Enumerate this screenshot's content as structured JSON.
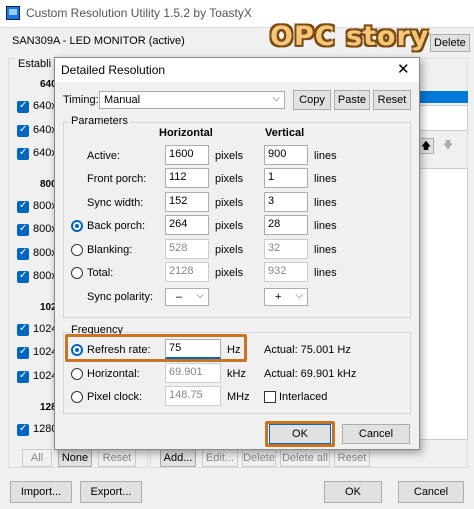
{
  "app": {
    "title": "Custom Resolution Utility 1.5.2 by ToastyX",
    "monitor": "SAN309A - LED MONITOR (active)",
    "delete_label": "Delete",
    "watermark": "OPC story"
  },
  "background": {
    "group_label": "Establi",
    "sections": [
      {
        "label": "640",
        "items": [
          "640x",
          "640x",
          "640x"
        ]
      },
      {
        "label": "800",
        "items": [
          "800x",
          "800x",
          "800x",
          "800x"
        ]
      },
      {
        "label": "102",
        "items": [
          "1024",
          "1024",
          "1024"
        ]
      },
      {
        "label": "128",
        "items": [
          "1280"
        ]
      }
    ],
    "left_buttons": [
      "All",
      "None",
      "Reset"
    ],
    "right_buttons": [
      "Add...",
      "Edit...",
      "Delete",
      "Delete all",
      "Reset"
    ],
    "import_label": "Import...",
    "export_label": "Export...",
    "ok_label": "OK",
    "cancel_label": "Cancel"
  },
  "dialog": {
    "title": "Detailed Resolution",
    "close_glyph": "✕",
    "timing_label": "Timing:",
    "timing_value": "Manual",
    "copy_label": "Copy",
    "paste_label": "Paste",
    "reset_label": "Reset",
    "parameters_label": "Parameters",
    "horizontal_header": "Horizontal",
    "vertical_header": "Vertical",
    "rows": [
      {
        "label": "Active:",
        "h": "1600",
        "h_unit": "pixels",
        "v": "900",
        "v_unit": "lines"
      },
      {
        "label": "Front porch:",
        "h": "112",
        "h_unit": "pixels",
        "v": "1",
        "v_unit": "lines"
      },
      {
        "label": "Sync width:",
        "h": "152",
        "h_unit": "pixels",
        "v": "3",
        "v_unit": "lines"
      },
      {
        "label": "Back porch:",
        "h": "264",
        "h_unit": "pixels",
        "v": "28",
        "v_unit": "lines"
      },
      {
        "label": "Blanking:",
        "h": "528",
        "h_unit": "pixels",
        "v": "32",
        "v_unit": "lines"
      },
      {
        "label": "Total:",
        "h": "2128",
        "h_unit": "pixels",
        "v": "932",
        "v_unit": "lines"
      }
    ],
    "sync_polarity_label": "Sync polarity:",
    "h_polarity": "–",
    "v_polarity": "+",
    "frequency_label": "Frequency",
    "refresh_label": "Refresh rate:",
    "refresh_value": "75",
    "refresh_unit": "Hz",
    "refresh_actual": "Actual: 75.001 Hz",
    "hfreq_label": "Horizontal:",
    "hfreq_value": "69.901",
    "hfreq_unit": "kHz",
    "hfreq_actual": "Actual: 69.901 kHz",
    "pclk_label": "Pixel clock:",
    "pclk_value": "148.75",
    "pclk_unit": "MHz",
    "interlaced_label": "Interlaced",
    "ok_label": "OK",
    "cancel_label": "Cancel"
  },
  "colors": {
    "accent": "#0067c0",
    "highlight": "#c97420"
  }
}
